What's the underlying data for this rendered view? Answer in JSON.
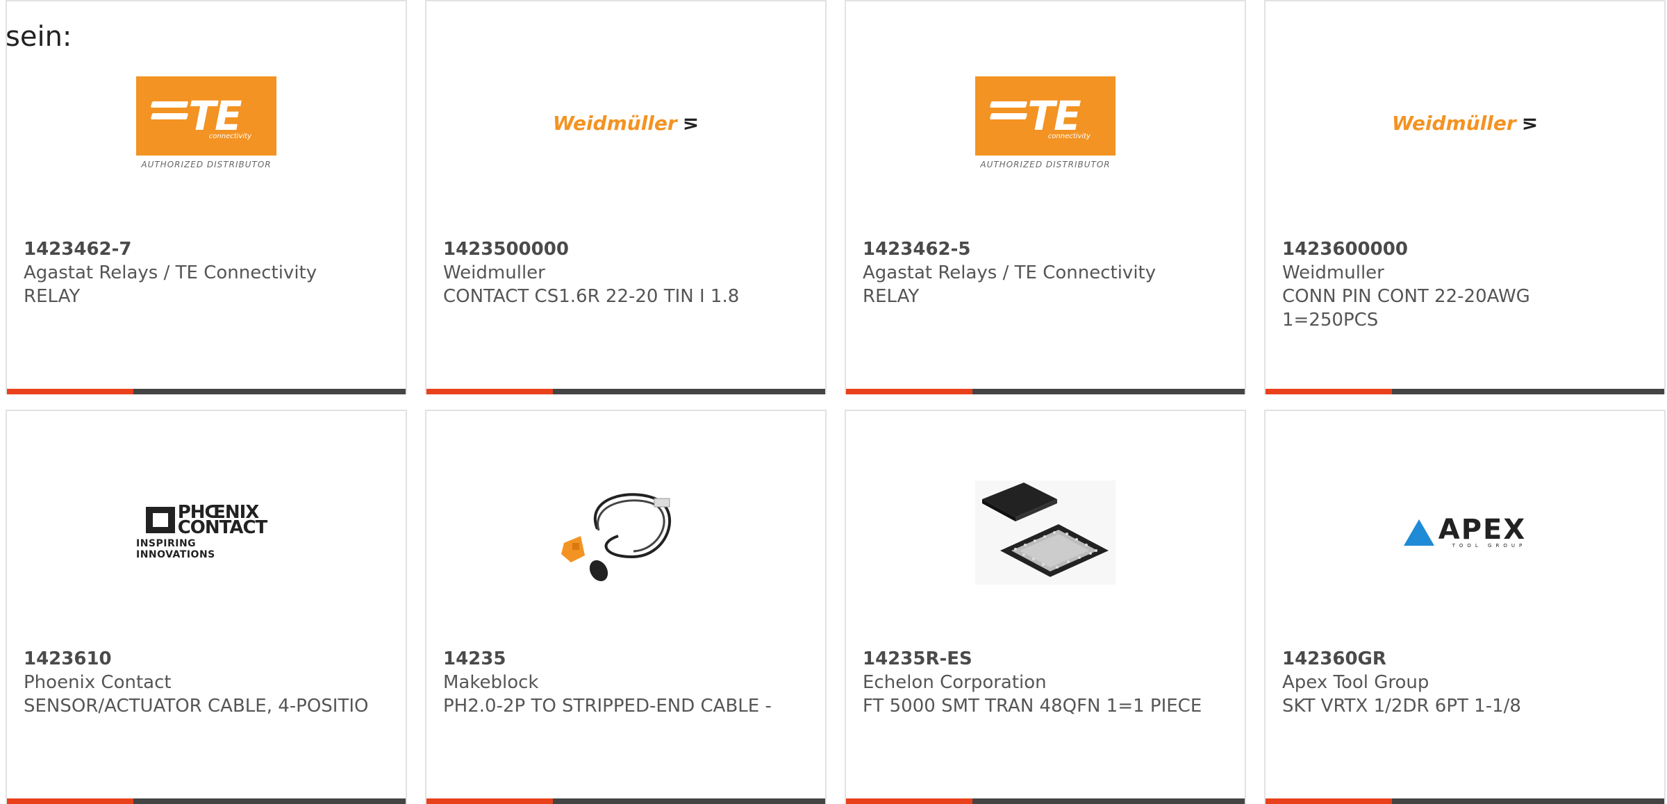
{
  "intro_text": "sein:",
  "colors": {
    "accent": "#e8411c",
    "bar": "#444444",
    "te_orange": "#f39323",
    "apex_blue": "#1f8ad6"
  },
  "logos": {
    "te": {
      "mark": "TE",
      "sub": "connectivity",
      "caption": "AUTHORIZED DISTRIBUTOR"
    },
    "weidmuller": {
      "name": "Weidmüller",
      "mark": "⋝"
    },
    "phoenix": {
      "line1": "PHŒNIX",
      "line2": "CONTACT",
      "tag": "INSPIRING INNOVATIONS"
    },
    "apex": {
      "name": "APEX",
      "sub": "TOOL GROUP"
    }
  },
  "products": [
    {
      "part": "1423462-7",
      "manufacturer": "Agastat Relays / TE Connectivity",
      "description": "RELAY",
      "image": "te-logo"
    },
    {
      "part": "1423500000",
      "manufacturer": "Weidmuller",
      "description": "CONTACT CS1.6R 22-20 TIN I 1.8",
      "image": "weidmuller-logo"
    },
    {
      "part": "1423462-5",
      "manufacturer": "Agastat Relays / TE Connectivity",
      "description": "RELAY",
      "image": "te-logo"
    },
    {
      "part": "1423600000",
      "manufacturer": "Weidmuller",
      "description": "CONN PIN CONT 22-20AWG 1=250PCS",
      "image": "weidmuller-logo"
    },
    {
      "part": "1423610",
      "manufacturer": "Phoenix Contact",
      "description": "SENSOR/ACTUATOR CABLE, 4-POSITIO",
      "image": "phoenix-logo"
    },
    {
      "part": "14235",
      "manufacturer": "Makeblock",
      "description": "PH2.0-2P TO STRIPPED-END CABLE -",
      "image": "cable-photo"
    },
    {
      "part": "14235R-ES",
      "manufacturer": "Echelon Corporation",
      "description": "FT 5000 SMT TRAN 48QFN 1=1 PIECE",
      "image": "chip-photo"
    },
    {
      "part": "142360GR",
      "manufacturer": "Apex Tool Group",
      "description": "SKT VRTX 1/2DR 6PT 1-1/8",
      "image": "apex-logo"
    }
  ]
}
